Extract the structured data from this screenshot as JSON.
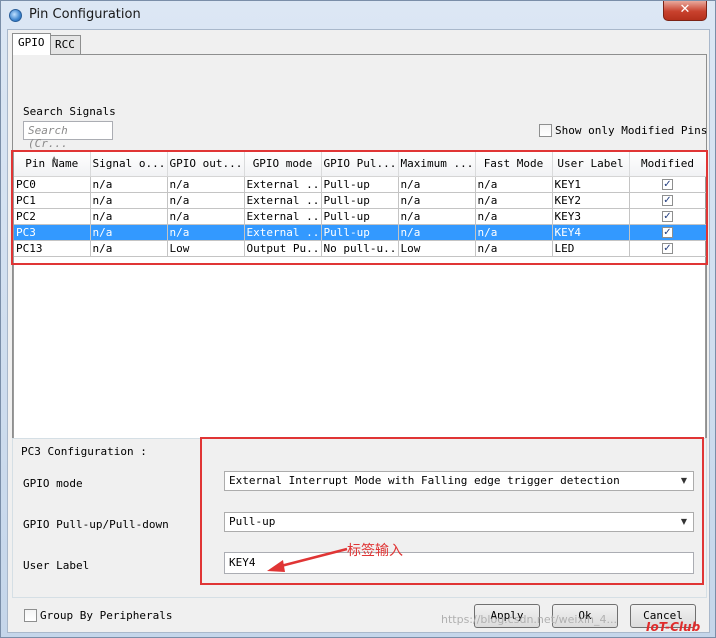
{
  "window": {
    "title": "Pin Configuration",
    "close_symbol": "✕"
  },
  "tabs": [
    {
      "label": "GPIO"
    },
    {
      "label": "RCC"
    }
  ],
  "search": {
    "label": "Search Signals",
    "placeholder": "Search (Cr..."
  },
  "show_only_modified": {
    "label": "Show only Modified Pins",
    "checked": false
  },
  "table": {
    "columns": [
      "Pin Name",
      "Signal o...",
      "GPIO out...",
      "GPIO mode",
      "GPIO Pul...",
      "Maximum ...",
      "Fast Mode",
      "User Label",
      "Modified"
    ],
    "rows": [
      {
        "pin": "PC0",
        "signal": "n/a",
        "gpio_out": "n/a",
        "mode": "External ...",
        "pull": "Pull-up",
        "max": "n/a",
        "fast": "n/a",
        "label": "KEY1",
        "modified": "✓"
      },
      {
        "pin": "PC1",
        "signal": "n/a",
        "gpio_out": "n/a",
        "mode": "External ...",
        "pull": "Pull-up",
        "max": "n/a",
        "fast": "n/a",
        "label": "KEY2",
        "modified": "✓"
      },
      {
        "pin": "PC2",
        "signal": "n/a",
        "gpio_out": "n/a",
        "mode": "External ...",
        "pull": "Pull-up",
        "max": "n/a",
        "fast": "n/a",
        "label": "KEY3",
        "modified": "✓"
      },
      {
        "pin": "PC3",
        "signal": "n/a",
        "gpio_out": "n/a",
        "mode": "External ...",
        "pull": "Pull-up",
        "max": "n/a",
        "fast": "n/a",
        "label": "KEY4",
        "modified": "✓",
        "selected": true
      },
      {
        "pin": "PC13",
        "signal": "n/a",
        "gpio_out": "Low",
        "mode": "Output Pu...",
        "pull": "No pull-u...",
        "max": "Low",
        "fast": "n/a",
        "label": "LED",
        "modified": "✓"
      }
    ]
  },
  "config": {
    "title": "PC3 Configuration :",
    "gpio_mode_label": "GPIO mode",
    "gpio_mode_value": "External Interrupt Mode with Falling edge trigger detection",
    "pull_label": "GPIO Pull-up/Pull-down",
    "pull_value": "Pull-up",
    "user_label_label": "User Label",
    "user_label_value": "KEY4",
    "dropdown_arrow": "▼"
  },
  "annotation": {
    "text": "标签输入",
    "color": "#e03535"
  },
  "footer": {
    "group_by": "Group By Peripherals",
    "apply": "Apply",
    "ok": "Ok",
    "cancel": "Cancel"
  },
  "watermark": "https://blog.csdn.net/weixin_4...",
  "badge": "IoT-Club",
  "colors": {
    "selection": "#3399ff",
    "highlight_box": "#e03535"
  }
}
